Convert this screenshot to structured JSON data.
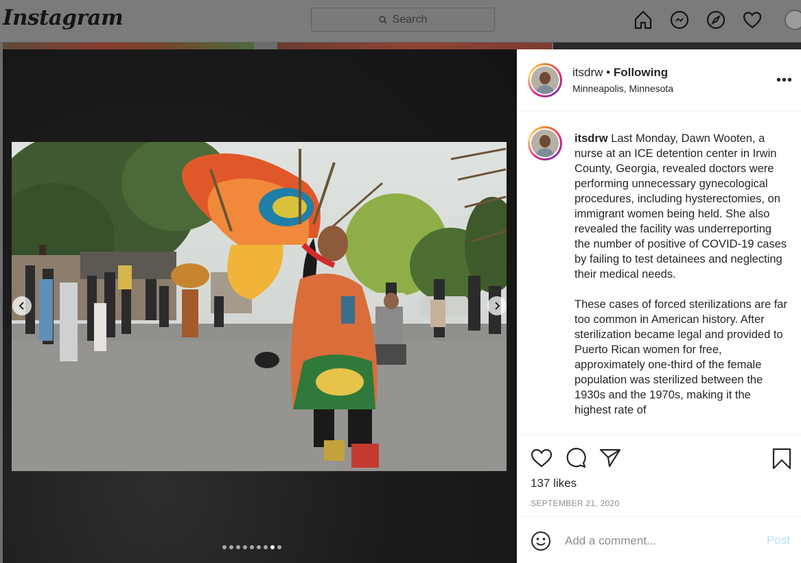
{
  "nav": {
    "logo": "Instagram",
    "search_placeholder": "Search",
    "icons": [
      "home-icon",
      "messenger-icon",
      "explore-compass-icon",
      "activity-heart-icon",
      "profile-avatar"
    ]
  },
  "post": {
    "username": "itsdrw",
    "separator": "•",
    "follow_status": "Following",
    "location": "Minneapolis, Minnesota",
    "more_label": "•••",
    "caption_username": "itsdrw",
    "caption_paragraphs": [
      "Last Monday, Dawn Wooten, a nurse at an ICE detention center in Irwin County, Georgia, revealed doctors were performing unnecessary gynecological procedures, including hysterectomies, on immigrant women being held. She also revealed the facility was underreporting the number of positive of COVID-19 cases by failing to test detainees and neglecting their medical needs.",
      "These cases of forced sterilizations are far too common in American history. After sterilization became legal and provided to Puerto Rican women for free, approximately one-third of the female population was sterilized between the 1930s and the 1970s, making it the highest rate of"
    ],
    "likes": "137 likes",
    "date": "SEPTEMBER 21, 2020",
    "comment_placeholder": "Add a comment...",
    "post_button": "Post",
    "carousel": {
      "total": 9,
      "active_index": 7
    }
  },
  "colors": {
    "accent_link": "#b2dffc",
    "text": "#262626",
    "muted": "#8e8e8e"
  }
}
